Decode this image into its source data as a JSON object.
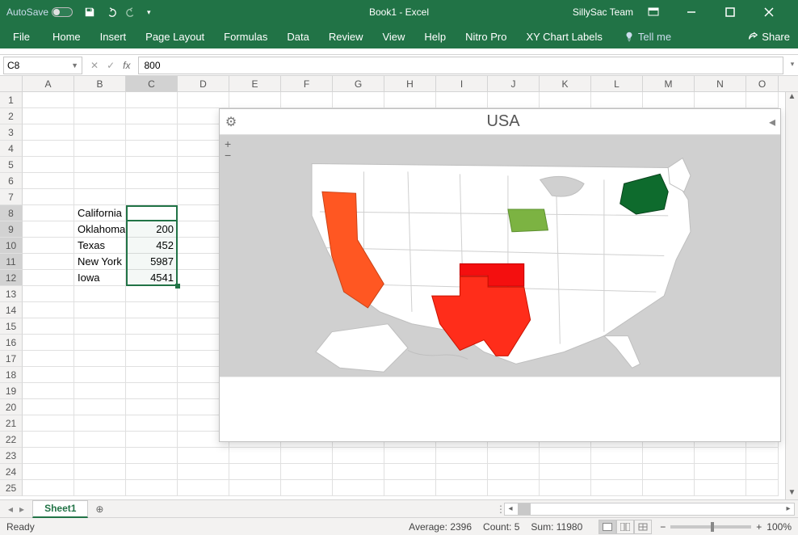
{
  "titlebar": {
    "autosave_label": "AutoSave",
    "document_title": "Book1 - Excel",
    "user_name": "SillySac Team"
  },
  "ribbon": {
    "tabs": [
      "File",
      "Home",
      "Insert",
      "Page Layout",
      "Formulas",
      "Data",
      "Review",
      "View",
      "Help",
      "Nitro Pro",
      "XY Chart Labels"
    ],
    "tellme_placeholder": "Tell me",
    "share_label": "Share"
  },
  "formula_bar": {
    "name_box": "C8",
    "formula": "800"
  },
  "columns": [
    "A",
    "B",
    "C",
    "D",
    "E",
    "F",
    "G",
    "H",
    "I",
    "J",
    "K",
    "L",
    "M",
    "N",
    "O"
  ],
  "row_headers": [
    1,
    2,
    3,
    4,
    5,
    6,
    7,
    8,
    9,
    10,
    11,
    12,
    13,
    14,
    15,
    16,
    17,
    18,
    19,
    20,
    21,
    22,
    23,
    24,
    25
  ],
  "selection": {
    "active": "C8",
    "range": "C8:C12"
  },
  "cells": {
    "B8": "California",
    "C8": "800",
    "B9": "Oklahoma",
    "C9": "200",
    "B10": "Texas",
    "C10": "452",
    "B11": "New York",
    "C11": "5987",
    "B12": "Iowa",
    "C12": "4541"
  },
  "chart": {
    "title": "USA",
    "states": [
      {
        "name": "California",
        "color": "#ff5722"
      },
      {
        "name": "Oklahoma",
        "color": "#f40f0f"
      },
      {
        "name": "Texas",
        "color": "#ff2d1a"
      },
      {
        "name": "New York",
        "color": "#0e6b2d"
      },
      {
        "name": "Iowa",
        "color": "#7cb342"
      }
    ]
  },
  "sheet_tabs": {
    "active": "Sheet1"
  },
  "status_bar": {
    "ready": "Ready",
    "average_label": "Average:",
    "average_value": "2396",
    "count_label": "Count:",
    "count_value": "5",
    "sum_label": "Sum:",
    "sum_value": "11980",
    "zoom": "100%"
  },
  "chart_data": {
    "type": "map",
    "title": "USA",
    "region": "United States",
    "series": [
      {
        "name": "California",
        "value": 800,
        "color": "#ff5722"
      },
      {
        "name": "Oklahoma",
        "value": 200,
        "color": "#f40f0f"
      },
      {
        "name": "Texas",
        "value": 452,
        "color": "#ff2d1a"
      },
      {
        "name": "New York",
        "value": 5987,
        "color": "#0e6b2d"
      },
      {
        "name": "Iowa",
        "value": 4541,
        "color": "#7cb342"
      }
    ],
    "notes": "Choropleth-style US state map; colored states correspond to rows B8:C12."
  }
}
